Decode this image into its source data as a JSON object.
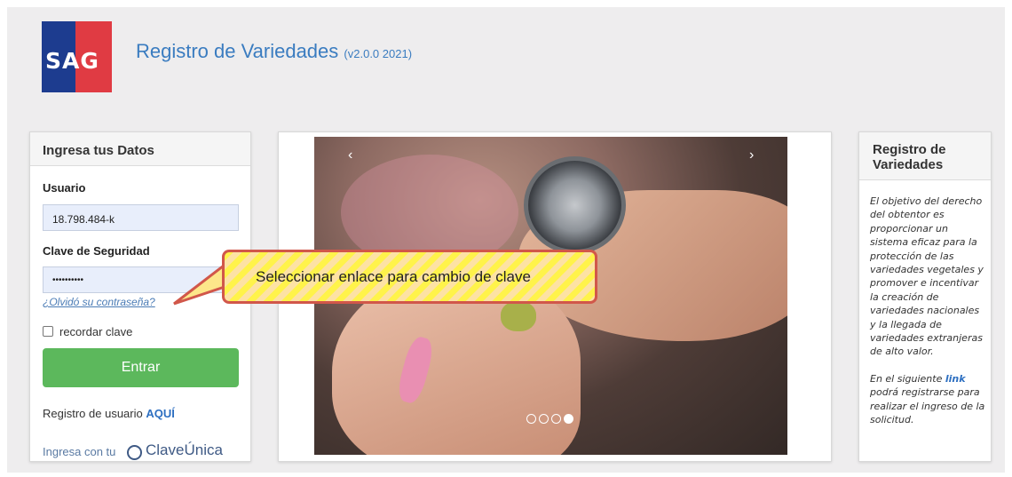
{
  "header": {
    "logo_text": "SAG",
    "title": "Registro de Variedades",
    "version": "(v2.0.0 2021)"
  },
  "login": {
    "heading": "Ingresa tus Datos",
    "user_label": "Usuario",
    "user_value": "18.798.484-k",
    "password_label": "Clave de Seguridad",
    "password_value": "••••••••••",
    "forgot_link": "¿Olvidó su contraseña?",
    "remember_label": "recordar clave",
    "submit_label": "Entrar",
    "register_text": "Registro de usuario",
    "register_link": "AQUÍ",
    "claveunica_prefix": "Ingresa con tu",
    "claveunica_brand": "ClaveÚnica"
  },
  "carousel": {
    "prev_symbol": "‹",
    "next_symbol": "›",
    "slide_count": 4,
    "active_slide": 4
  },
  "info": {
    "heading": "Registro de Variedades",
    "paragraph1": "El objetivo del derecho del obtentor es proporcionar un sistema eficaz para la protección de las variedades vegetales y promover e incentivar la creación de variedades nacionales y la llegada de variedades extranjeras de alto valor.",
    "paragraph2_before": "En el siguiente",
    "paragraph2_link": "link",
    "paragraph2_after": "podrá registrarse para realizar el ingreso de la solicitud."
  },
  "callout": {
    "text": "Seleccionar enlace para cambio de clave"
  },
  "colors": {
    "brand_blue": "#1d3c8f",
    "brand_red": "#e03b43",
    "title_blue": "#3a7cc0",
    "submit_green": "#5cb85c",
    "callout_yellow": "#fff34a",
    "callout_border": "#d1574a"
  }
}
